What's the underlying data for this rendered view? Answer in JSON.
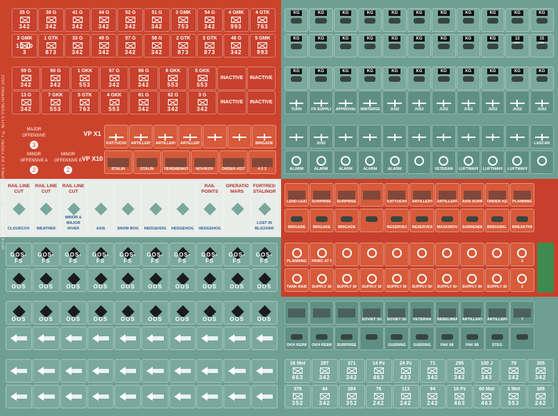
{
  "side_text": "OFFENSIVE ROADS - COUNTERSHEET 2/2 FRONT • © NUTS PUBLISHING 2022",
  "sov_row1": [
    {
      "id": "35 G",
      "nums": "342"
    },
    {
      "id": "38 G",
      "nums": "342"
    },
    {
      "id": "41 G",
      "nums": "342"
    },
    {
      "id": "44 G",
      "nums": "342"
    },
    {
      "id": "52 G",
      "nums": "342"
    },
    {
      "id": "51 G",
      "nums": "342"
    },
    {
      "id": "3 GMK",
      "nums": "753"
    },
    {
      "id": "54 G",
      "nums": "342"
    },
    {
      "id": "4 GMK",
      "nums": "993"
    },
    {
      "id": "4 GTK",
      "nums": "763"
    }
  ],
  "sov_row2": [
    {
      "id": "2 GMK",
      "nums": "10 10 3"
    },
    {
      "id": "1 GTK",
      "nums": "873"
    },
    {
      "id": "33 G",
      "nums": "342"
    },
    {
      "id": "49 G",
      "nums": "342"
    },
    {
      "id": "57 G",
      "nums": "342"
    },
    {
      "id": "58 G",
      "nums": "342"
    },
    {
      "id": "2 GTK",
      "nums": "873"
    },
    {
      "id": "3 GTK",
      "nums": "873"
    },
    {
      "id": "48 G",
      "nums": "342"
    },
    {
      "id": "5 GMK",
      "nums": "993"
    }
  ],
  "sov_row3": [
    {
      "id": "59 G",
      "nums": "342"
    },
    {
      "id": "60 G",
      "nums": "342"
    },
    {
      "id": "1 GKK",
      "nums": "553"
    },
    {
      "id": "67 G",
      "nums": "342"
    },
    {
      "id": "66 G",
      "nums": "342"
    },
    {
      "id": "6 GKK",
      "nums": "553"
    },
    {
      "id": "5 GKK",
      "nums": "553"
    },
    {
      "id": "INACTIVE",
      "nums": ""
    },
    {
      "id": "INACTIVE",
      "nums": ""
    }
  ],
  "sov_row4": [
    {
      "id": "13 G",
      "nums": "342"
    },
    {
      "id": "7 GKK",
      "nums": "553"
    },
    {
      "id": "5 GTK",
      "nums": "763"
    },
    {
      "id": "4 GKK",
      "nums": "553"
    },
    {
      "id": "61 G",
      "nums": "342"
    },
    {
      "id": "62 G",
      "nums": "342"
    },
    {
      "id": "3 G",
      "nums": "342"
    },
    {
      "id": "INACTIVE",
      "nums": ""
    },
    {
      "id": "INACTIVE",
      "nums": ""
    }
  ],
  "offensive": {
    "major_label": "MAJOR OFFENSIVE",
    "major_num": "3",
    "minor_a_label": "MINOR OFFENSIVE A",
    "minor_a_num": "2",
    "minor_b_label": "MINOR OFFENSIVE B",
    "minor_b_num": "2",
    "vp1": "VP X1",
    "vp10": "VP X10"
  },
  "sov_markers_r1": [
    "KATYUCHA",
    "ARTILLERY",
    "ARTILLERY",
    "ARTILLERY",
    "",
    "",
    "BRIGADE"
  ],
  "sov_markers_r2": [
    "STALIN",
    "STALIN",
    "YEREMENKO",
    "NOVIKOV",
    "ORDER #227",
    "4 2 3"
  ],
  "white_row": {
    "labels": [
      "RAIL LINE CUT",
      "RAIL LINE CUT",
      "RAIL LINE CUT",
      "",
      "",
      "",
      "",
      "RAIL POINTS",
      "OPERATION MARS",
      "FORTRESS STALINGRAD"
    ],
    "bottom": [
      "CLOUDCOVER",
      "WEATHER",
      "MINOR & MAJOR RIVER",
      "AXIS",
      "SNOW BOG",
      "HEDGEHOG",
      "HEDGEHOG",
      "HEDGEHOG",
      "",
      "LOST IN BLIZZARD"
    ]
  },
  "oos_fs_label": "OOS-FS",
  "oos_label": "OOS",
  "ger_row1": [
    "KG",
    "KG",
    "KG",
    "KG",
    "KG",
    "KG",
    "KG",
    "KG",
    "KG",
    "KG",
    "KG"
  ],
  "ger_row2": [
    "KG",
    "KG",
    "KG",
    "KG",
    "KG",
    "KG",
    "KG",
    "KG",
    "KG",
    "13 IGL",
    "15 IGL"
  ],
  "ger_row3": [
    "KG",
    "KG",
    "KG",
    "KG",
    "KG",
    "KG",
    "KG",
    "KG",
    "KG",
    "KG",
    "KG"
  ],
  "ger_row4": [
    "TURN",
    "FS SUPPLY",
    "APPROVAL",
    "WINTERGEWITTER MANSTEIN",
    "JU52",
    "JU52",
    "JU52",
    "JU52",
    "JU52",
    "JU52",
    "JU52"
  ],
  "ger_row5": [
    "",
    "JU52",
    "",
    "",
    "",
    "",
    "",
    "",
    "",
    "",
    "LASCAR"
  ],
  "ger_row6": [
    "ALARM",
    "ALARM",
    "ALARM",
    "ALARM",
    "ALARM",
    "",
    "VETERAN",
    "LUFTWAFFE",
    "LUFTWAFFE",
    "LUFTWAFFE",
    ""
  ],
  "red_right_r1": [
    "LEND LEASE",
    "SURPRISE ATT.",
    "SURPRISE ATT.",
    "",
    "KATYUCHA",
    "ARTILLERY",
    "ARTILLERY",
    "AXIS SURRENDER",
    "ORDER #227",
    "PLANNING"
  ],
  "red_right_r2": [
    "BRIGADE",
    "BRIGADE",
    "BRIGADE",
    "",
    "RESERVES",
    "RESERVES",
    "MASKIROVKA",
    "SURRENDER",
    "BRIDGING UNIT",
    "BREAKTHROUGH"
  ],
  "red_right_r3": [
    "PLANNING",
    "PANIC AT REAR",
    "",
    "",
    "",
    "",
    "",
    "",
    "",
    "2"
  ],
  "red_right_r4": [
    "TANK RAID!",
    "SUPPLY SHORTAGE",
    "SUPPLY SHORTAGE",
    "SUPPLY SHORTAGE",
    "SUPPLY SHORTAGE",
    "SUPPLY SHORTAGE",
    "SUPPLY SHORTAGE",
    "SUPPLY SHORTAGE",
    "SUPPLY SHORTAGE",
    "2"
  ],
  "ger_lower_r1": [
    "",
    "",
    "",
    "SOVIET SURRENDER",
    "SOVIET SURRENDER",
    "VETERAN",
    "NEBELWERFER",
    "ARTILLERY",
    "ARTILLERY",
    "7"
  ],
  "ger_lower_r2": [
    "OKH REINFORCEMENT",
    "OKH REINFORCEMENT",
    "SURPRISE ATT.",
    "",
    "GUERING",
    "GUERING",
    "PAK 88",
    "PAK 88",
    "STEG",
    ""
  ],
  "ger_units_r1": [
    {
      "id": "16 Mot",
      "nums": "663"
    },
    {
      "id": "297",
      "nums": "342"
    },
    {
      "id": "371",
      "nums": "342"
    },
    {
      "id": "14 Pz",
      "nums": "463"
    },
    {
      "id": "24 Pz",
      "nums": "433"
    },
    {
      "id": "71",
      "nums": "342"
    },
    {
      "id": "295",
      "nums": "342"
    },
    {
      "id": "100 J",
      "nums": "343"
    },
    {
      "id": "79",
      "nums": "342"
    },
    {
      "id": "305",
      "nums": "342"
    }
  ],
  "ger_units_r2": [
    {
      "id": "376",
      "nums": "352"
    },
    {
      "id": "44",
      "nums": "342"
    },
    {
      "id": "384",
      "nums": "352"
    },
    {
      "id": "76",
      "nums": "242"
    },
    {
      "id": "113",
      "nums": "242"
    },
    {
      "id": "94",
      "nums": "242"
    },
    {
      "id": "16 Pz",
      "nums": "463"
    },
    {
      "id": "60 Mot",
      "nums": "463"
    },
    {
      "id": "3 Mot",
      "nums": "553"
    },
    {
      "id": "389",
      "nums": "242"
    }
  ]
}
